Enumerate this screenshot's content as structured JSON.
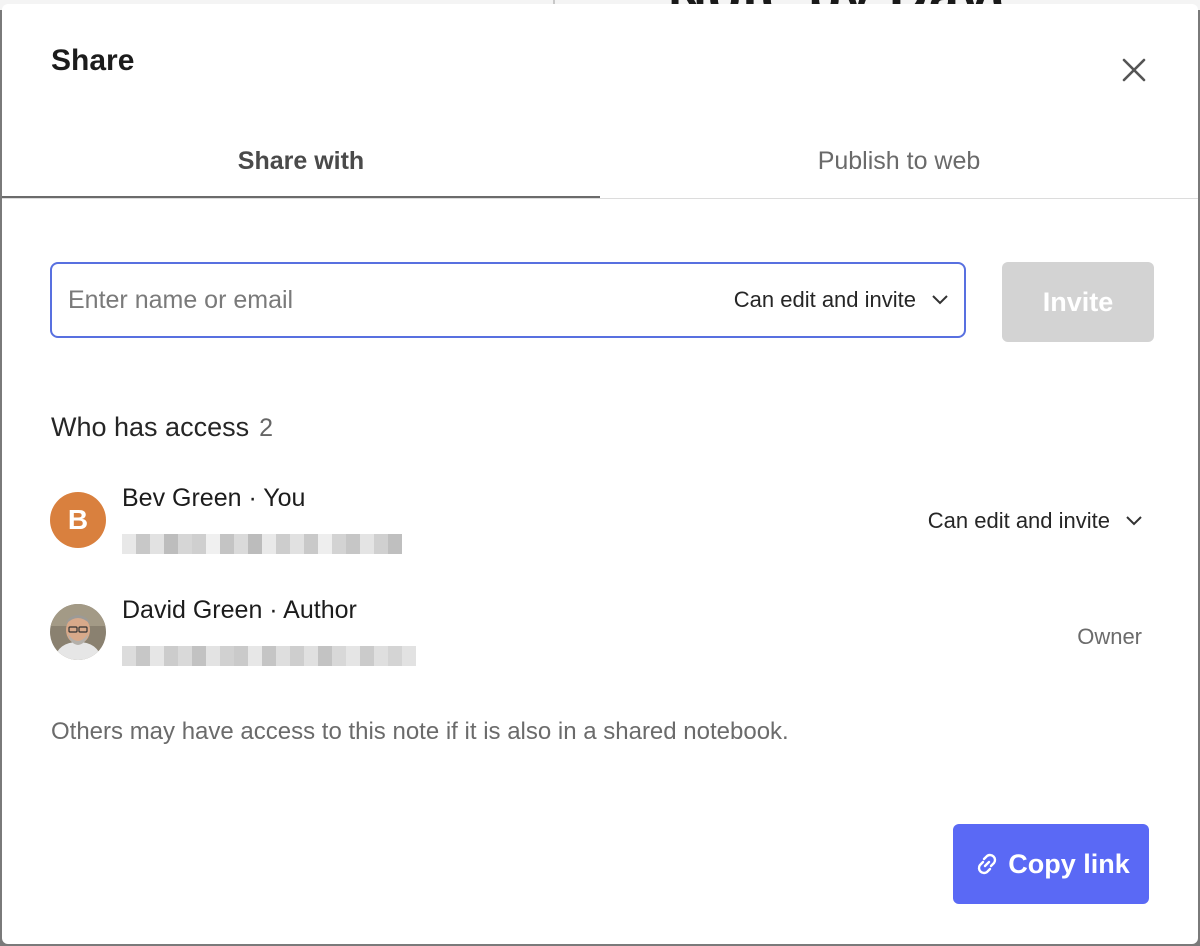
{
  "background": {
    "peek_text": "Note by Dave"
  },
  "dialog": {
    "title": "Share",
    "close_icon": "close-icon"
  },
  "tabs": [
    {
      "label": "Share with",
      "active": true
    },
    {
      "label": "Publish to web",
      "active": false
    }
  ],
  "invite": {
    "placeholder": "Enter name or email",
    "permission": "Can edit and invite",
    "button_label": "Invite",
    "button_enabled": false
  },
  "access": {
    "heading": "Who has access",
    "count": "2",
    "people": [
      {
        "name": "Bev Green · You",
        "avatar_letter": "B",
        "avatar_color": "#d9803e",
        "permission": "Can edit and invite"
      },
      {
        "name": "David Green · Author",
        "avatar": "photo",
        "permission": "Owner"
      }
    ]
  },
  "note": "Others may have access to this note if it is also in a shared notebook.",
  "copy_link": {
    "label": "Copy link",
    "icon": "link-icon",
    "color": "#5a69f5"
  }
}
